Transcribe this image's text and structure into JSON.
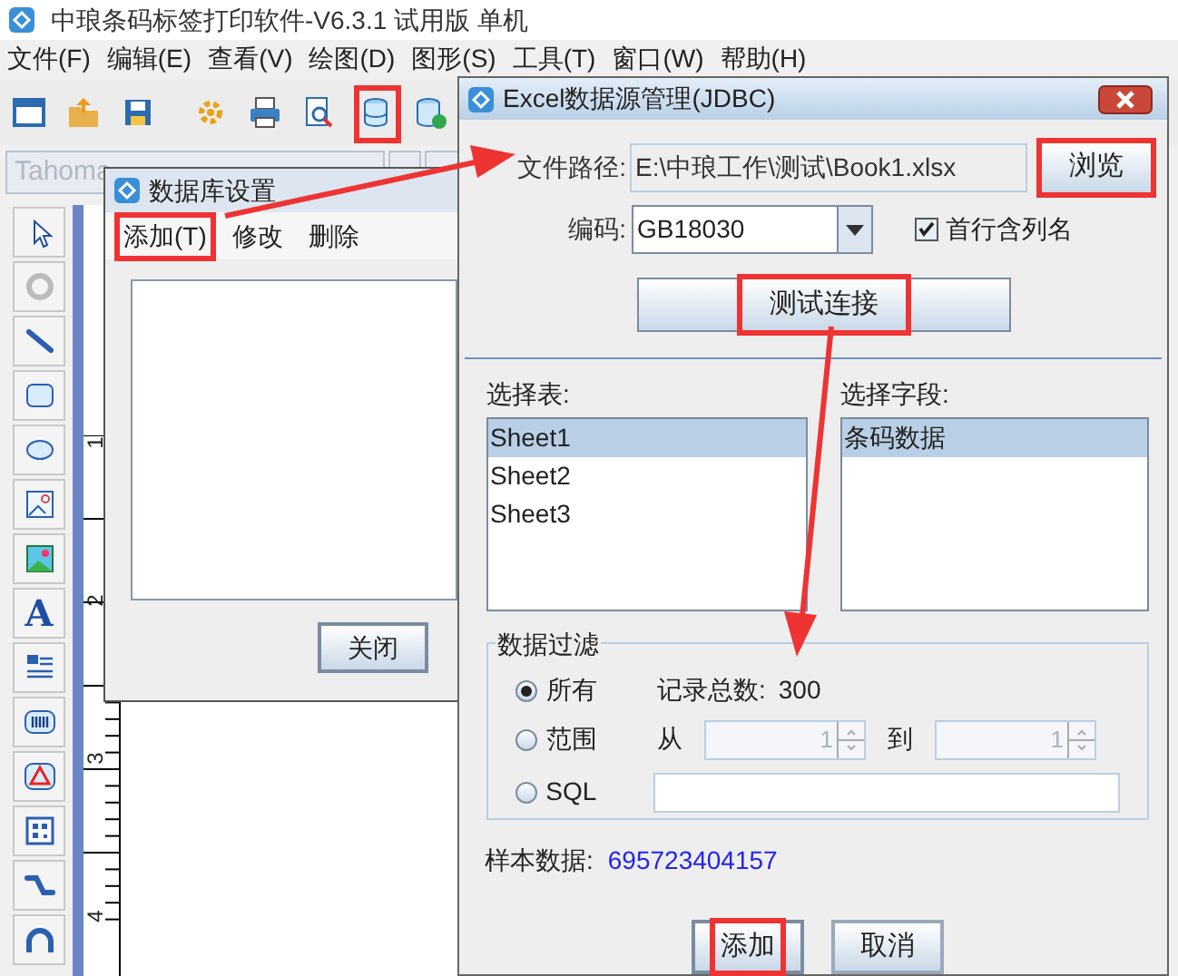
{
  "app": {
    "title": "中琅条码标签打印软件-V6.3.1 试用版 单机",
    "menu": [
      "文件(F)",
      "编辑(E)",
      "查看(V)",
      "绘图(D)",
      "图形(S)",
      "工具(T)",
      "窗口(W)",
      "帮助(H)"
    ],
    "font_field": {
      "value": "Tahoma"
    },
    "text_tool_glyph": "A",
    "ruler_labels": [
      "1",
      "2",
      "3",
      "4"
    ]
  },
  "db_dialog": {
    "title": "数据库设置",
    "menu": [
      {
        "label": "添加(T)",
        "highlighted": true
      },
      {
        "label": "修改",
        "highlighted": false
      },
      {
        "label": "删除",
        "highlighted": false
      }
    ],
    "close_button": "关闭"
  },
  "excel_dialog": {
    "title": "Excel数据源管理(JDBC)",
    "file_path_label": "文件路径:",
    "file_path": "E:\\中琅工作\\测试\\Book1.xlsx",
    "browse_button": {
      "label": "浏览",
      "highlighted": true
    },
    "encoding_label": "编码:",
    "encoding": "GB18030",
    "header_row": {
      "label": "首行含列名",
      "checked": true
    },
    "test_button": {
      "label": "测试连接",
      "highlighted": true
    },
    "tables_label": "选择表:",
    "tables": [
      {
        "label": "Sheet1",
        "selected": true
      },
      {
        "label": "Sheet2",
        "selected": false
      },
      {
        "label": "Sheet3",
        "selected": false
      }
    ],
    "fields_label": "选择字段:",
    "fields": [
      {
        "label": "条码数据",
        "selected": true
      }
    ],
    "filter": {
      "title": "数据过滤",
      "options": [
        {
          "label": "所有",
          "selected": true
        },
        {
          "label": "范围",
          "selected": false
        },
        {
          "label": "SQL",
          "selected": false
        }
      ],
      "record_count_label": "记录总数:",
      "record_count": "300",
      "from_label": "从",
      "from": "1",
      "to_label": "到",
      "to": "1"
    },
    "sample_label": "样本数据:",
    "sample_value": "695723404157",
    "buttons": [
      {
        "label": "添加",
        "highlighted": true
      },
      {
        "label": "取消",
        "highlighted": false
      }
    ]
  }
}
